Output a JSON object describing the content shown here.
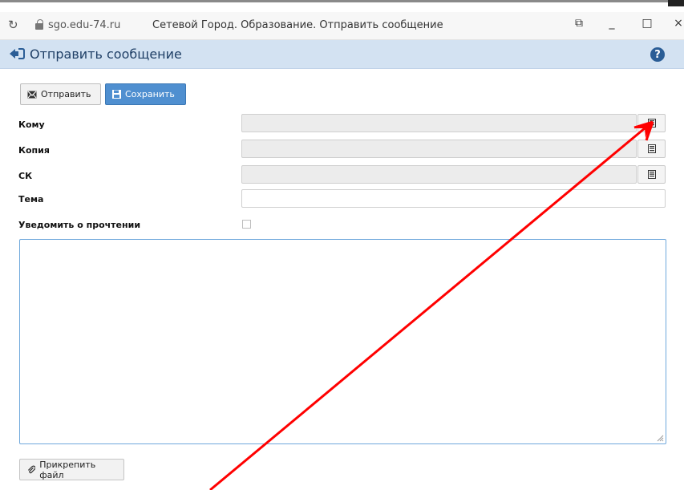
{
  "browser": {
    "url": "sgo.edu-74.ru",
    "page_title": "Сетевой Город. Образование. Отправить сообщение",
    "reload_icon": "reload-icon",
    "window_controls": {
      "share": "⧉",
      "minimize": "_",
      "maximize": "□",
      "close": "×"
    }
  },
  "header": {
    "title": "Отправить сообщение",
    "back_icon": "back-arrow-icon",
    "help_label": "?"
  },
  "toolbar": {
    "send_label": "Отправить",
    "save_label": "Сохранить"
  },
  "form": {
    "to_label": "Кому",
    "to_value": "",
    "cc_label": "Копия",
    "cc_value": "",
    "bcc_label": "СК",
    "bcc_value": "",
    "subject_label": "Тема",
    "subject_value": "",
    "read_receipt_label": "Уведомить о прочтении",
    "read_receipt_checked": false,
    "body_value": ""
  },
  "attach": {
    "label": "Прикрепить файл"
  },
  "colors": {
    "header_bg": "#d3e2f2",
    "save_button": "#4f8fd0",
    "annotation_arrow": "#ff0000",
    "help_icon": "#2a5d96"
  }
}
